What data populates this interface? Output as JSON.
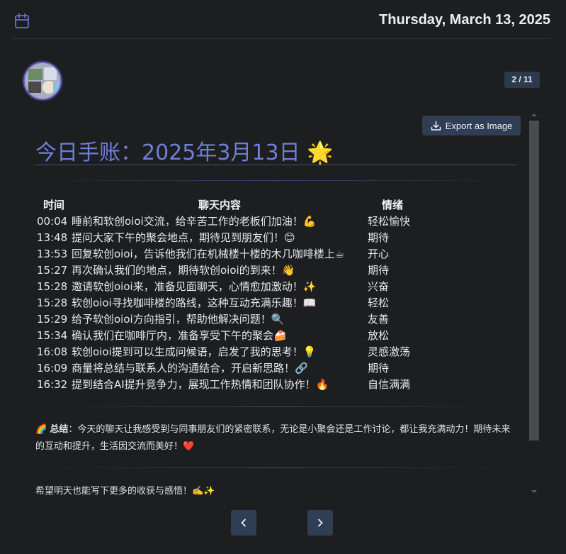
{
  "header": {
    "date": "Thursday, March 13, 2025",
    "icon": "calendar-icon"
  },
  "pager": {
    "indicator": "2 / 11"
  },
  "toolbar": {
    "export_label": "Export as Image",
    "export_icon": "download-icon"
  },
  "journal": {
    "title": "今日手账：2025年3月13日 🌟",
    "columns": [
      "时间",
      "聊天内容",
      "情绪"
    ],
    "rows": [
      {
        "time": "00:04",
        "message": "睡前和软创oioi交流，给辛苦工作的老板们加油！💪",
        "mood": "轻松愉快"
      },
      {
        "time": "13:48",
        "message": "提问大家下午的聚会地点，期待见到朋友们！😊",
        "mood": "期待"
      },
      {
        "time": "13:53",
        "message": "回复软创oioi，告诉他我们在机械楼十楼的木几咖啡楼上☕",
        "mood": "开心"
      },
      {
        "time": "15:27",
        "message": "再次确认我们的地点，期待软创oioi的到来！👋",
        "mood": "期待"
      },
      {
        "time": "15:28",
        "message": "邀请软创oioi来，准备见面聊天，心情愈加激动！✨",
        "mood": "兴奋"
      },
      {
        "time": "15:28",
        "message": "软创oioi寻找咖啡楼的路线，这种互动充满乐趣！📖",
        "mood": "轻松"
      },
      {
        "time": "15:29",
        "message": "给予软创oioi方向指引，帮助他解决问题！🔍",
        "mood": "友善"
      },
      {
        "time": "15:34",
        "message": "确认我们在咖啡厅内，准备享受下午的聚会🍰",
        "mood": "放松"
      },
      {
        "time": "16:08",
        "message": "软创oioi提到可以生成问候语，启发了我的思考！💡",
        "mood": "灵感激荡"
      },
      {
        "time": "16:09",
        "message": "商量将总结与联系人的沟通结合，开启新思路！🔗",
        "mood": "期待"
      },
      {
        "time": "16:32",
        "message": "提到结合AI提升竞争力，展现工作热情和团队协作！🔥",
        "mood": "自信满满"
      }
    ],
    "summary_emoji": "🌈",
    "summary_label": "总结",
    "summary_text": "：今天的聊天让我感受到与同事朋友们的紧密联系，无论是小聚会还是工作讨论，都让我充满动力！期待未来的互动和提升，生活因交流而美好！❤️",
    "closing": "希望明天也能写下更多的收获与感悟！✍️✨"
  },
  "nav": {
    "prev_icon": "chevron-left-icon",
    "next_icon": "chevron-right-icon"
  }
}
